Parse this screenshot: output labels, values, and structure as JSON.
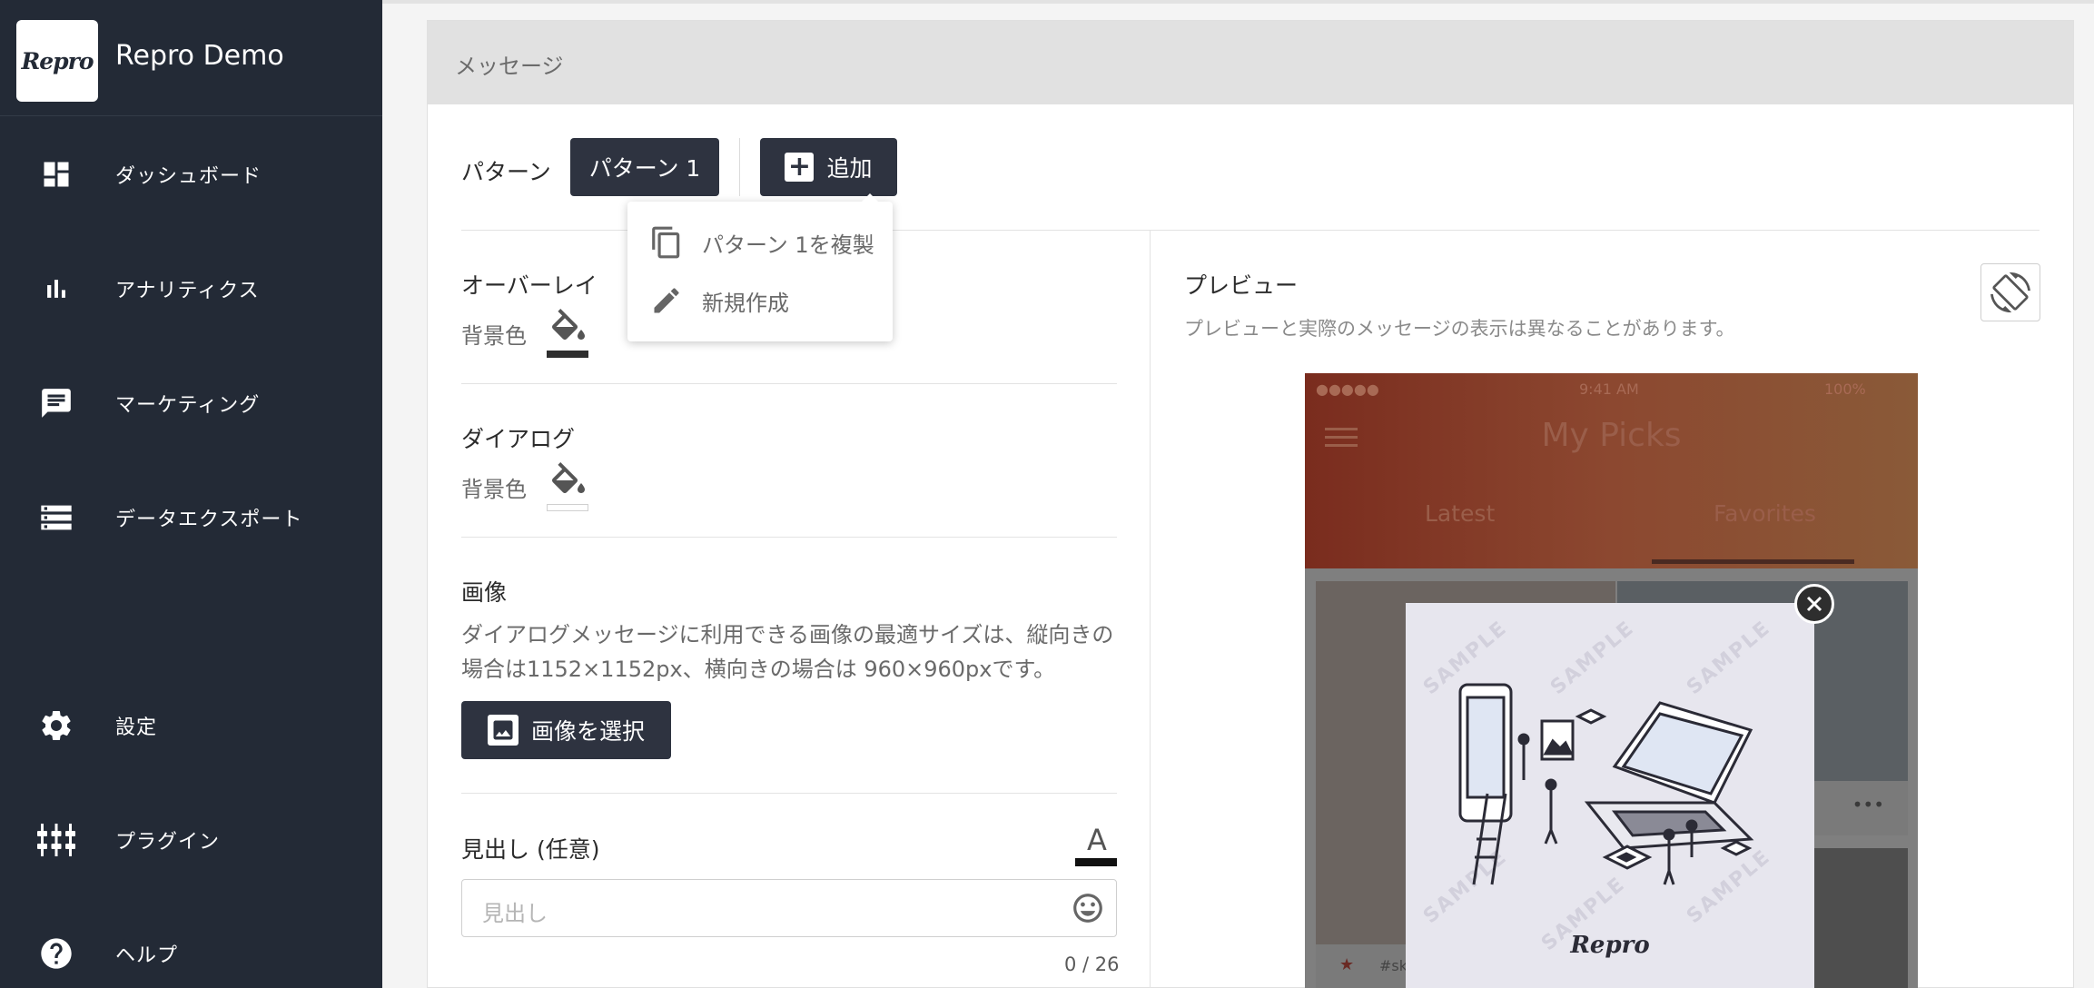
{
  "app": {
    "logo_text": "Repro",
    "name": "Repro Demo"
  },
  "sidebar": {
    "items": [
      {
        "label": "ダッシュボード",
        "icon": "dashboard-icon"
      },
      {
        "label": "アナリティクス",
        "icon": "bar-chart-icon"
      },
      {
        "label": "マーケティング",
        "icon": "chat-bubble-icon"
      },
      {
        "label": "データエクスポート",
        "icon": "list-storage-icon"
      },
      {
        "label": "設定",
        "icon": "gear-icon"
      },
      {
        "label": "プラグイン",
        "icon": "sliders-icon"
      },
      {
        "label": "ヘルプ",
        "icon": "help-icon"
      }
    ]
  },
  "card": {
    "title": "メッセージ"
  },
  "pattern": {
    "label": "パターン",
    "current": "パターン 1",
    "add_label": "追加",
    "menu": [
      {
        "label": "パターン 1を複製",
        "icon": "copy-icon"
      },
      {
        "label": "新規作成",
        "icon": "pencil-icon"
      }
    ]
  },
  "form": {
    "overlay": {
      "title": "オーバーレイ",
      "bg_label": "背景色",
      "bg_color": "#2e2e2e"
    },
    "dialog": {
      "title": "ダイアログ",
      "bg_label": "背景色",
      "bg_color": "#ffffff"
    },
    "image": {
      "title": "画像",
      "description": "ダイアログメッセージに利用できる画像の最適サイズは、縦向きの場合は1152×1152px、横向きの場合は 960×960pxです。",
      "button": "画像を選択"
    },
    "heading": {
      "title": "見出し (任意)",
      "text_color_glyph": "A",
      "placeholder": "見出し",
      "counter": "0 / 26"
    }
  },
  "preview": {
    "title": "プレビュー",
    "note": "プレビューと実際のメッセージの表示は異なることがあります。",
    "phone": {
      "time": "9:41 AM",
      "battery": "100%",
      "app_title": "My Picks",
      "tabs": [
        "Latest",
        "Favorites"
      ],
      "card_more": "•••",
      "card_tag": "#ska"
    },
    "image": {
      "watermark": "SAMPLE",
      "brand": "Repro"
    }
  }
}
